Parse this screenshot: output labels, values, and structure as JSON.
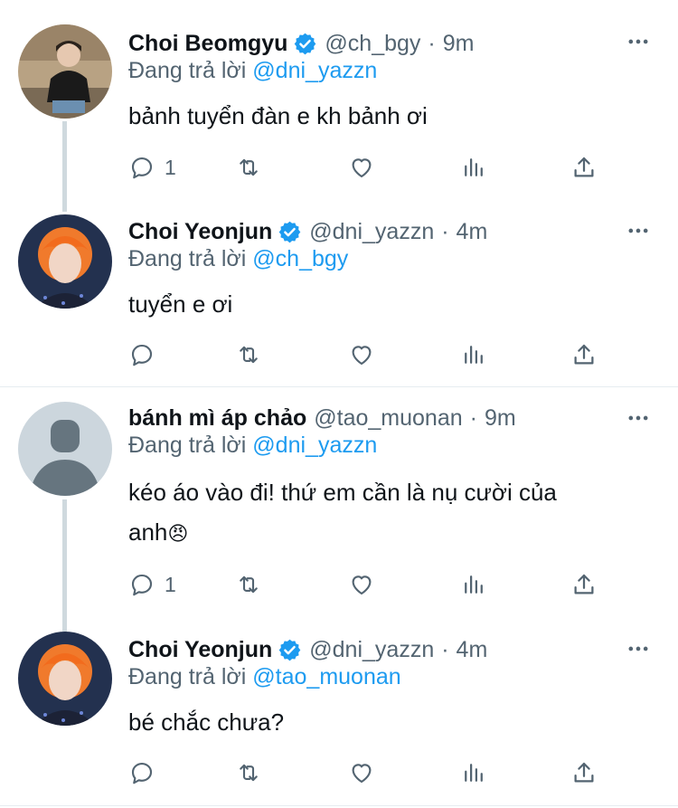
{
  "replying_label": "Đang trả lời",
  "colors": {
    "accent": "#1d9bf0",
    "muted": "#536471",
    "text": "#0f1419"
  },
  "tweets": [
    {
      "name": "Choi Beomgyu",
      "handle": "@ch_bgy",
      "time": "9m",
      "verified": true,
      "replying_to": "@dni_yazzn",
      "text": "bảnh tuyển đàn e kh bảnh ơi",
      "reply_count": "1"
    },
    {
      "name": "Choi Yeonjun",
      "handle": "@dni_yazzn",
      "time": "4m",
      "verified": true,
      "replying_to": "@ch_bgy",
      "text": "tuyển e ơi",
      "reply_count": ""
    },
    {
      "name": "bánh mì áp chảo",
      "handle": "@tao_muonan",
      "time": "9m",
      "verified": false,
      "replying_to": "@dni_yazzn",
      "text_line1": "kéo áo vào đi! thứ em cần là nụ cười của",
      "text_line2": "anh",
      "emoji": "😠",
      "reply_count": "1"
    },
    {
      "name": "Choi Yeonjun",
      "handle": "@dni_yazzn",
      "time": "4m",
      "verified": true,
      "replying_to": "@tao_muonan",
      "text": "bé chắc chưa?",
      "reply_count": ""
    }
  ],
  "icons": [
    "reply-icon",
    "retweet-icon",
    "like-icon",
    "analytics-icon",
    "share-icon",
    "more-icon",
    "verified-icon"
  ]
}
